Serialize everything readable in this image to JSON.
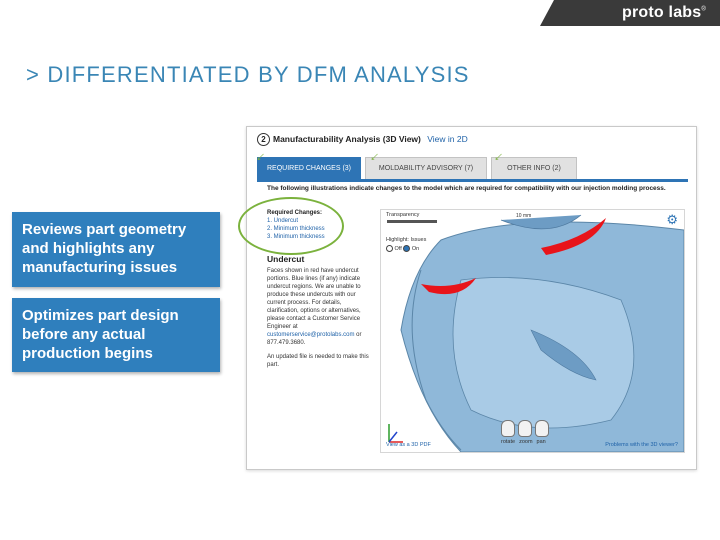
{
  "brand": {
    "name": "proto labs",
    "reg": "®"
  },
  "title": "> DIFFERENTIATED BY DFM ANALYSIS",
  "callouts": [
    "Reviews part geometry and highlights any manufacturing issues",
    "Optimizes part design before any actual production begins"
  ],
  "screenshot": {
    "step": "2",
    "heading": "Manufacturability Analysis",
    "heading_sub": "(3D View)",
    "view_link": "View in 2D",
    "tabs": [
      "REQUIRED CHANGES (3)",
      "MOLDABILITY ADVISORY (7)",
      "OTHER INFO (2)"
    ],
    "intro": "The following illustrations indicate changes to the model which are required for compatibility with our injection molding process.",
    "required_heading": "Required Changes:",
    "required_items": [
      "1. Undercut",
      "2. Minimum thickness",
      "3. Minimum thickness"
    ],
    "undercut_title": "Undercut",
    "undercut_body": "Faces shown in red have undercut portions. Blue lines (if any) indicate undercut regions. We are unable to produce these undercuts with our current process. For details, clarification, options or alternatives, please contact a Customer Service Engineer at",
    "email": "customerservice@protolabs.com",
    "phone_suffix": " or 877.479.3680.",
    "updated_note": "An updated file is needed to make this part.",
    "viewer": {
      "transparency_label": "Transparency",
      "highlight_label": "Highlight: Issues",
      "off": "Off",
      "on": "On",
      "scale_label": "10 mm",
      "mouse_labels": [
        "rotate",
        "zoom",
        "pan"
      ],
      "pdf_link": "View as a 3D PDF",
      "problems_link": "Problems with the 3D viewer?"
    }
  },
  "colors": {
    "accent": "#3a86b5",
    "callout": "#2f7fbd",
    "highlight": "#7bb23d",
    "issue": "#e8141a"
  }
}
